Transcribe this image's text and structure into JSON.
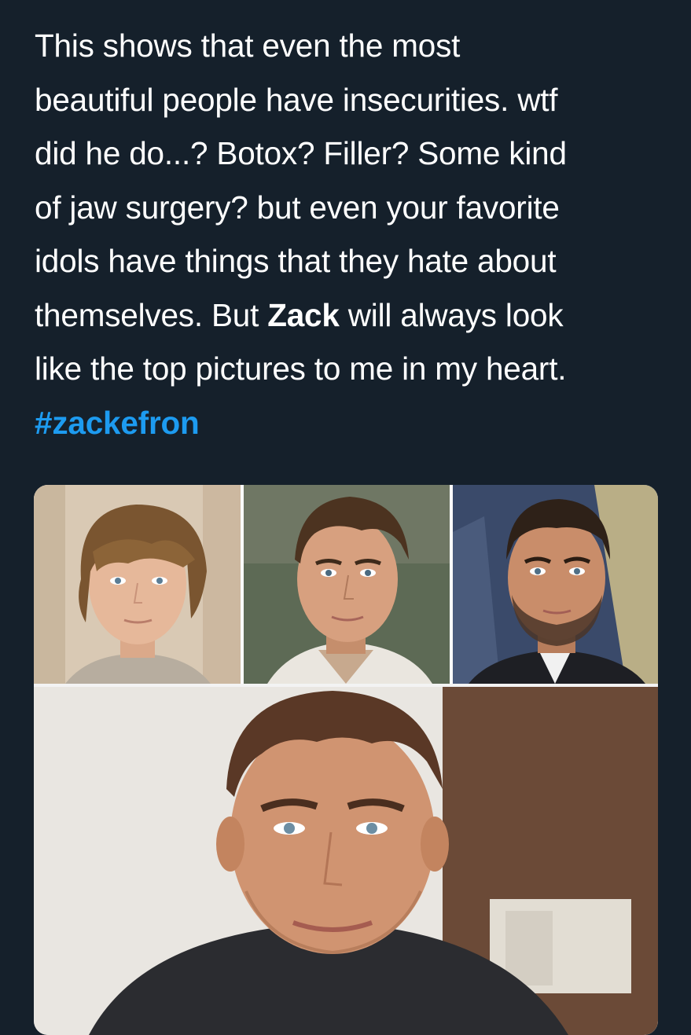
{
  "tweet": {
    "text_before_name": "This shows that even the most\nbeautiful people have insecurities. wtf\ndid he do...? Botox? Filler? Some kind\nof jaw surgery? but even your favorite\nidols have things that they hate about\nthemselves. But ",
    "bold_name": "Zack",
    "text_after_name": " will always look\nlike the top pictures to me in my heart.",
    "hashtag": "#zackefron"
  },
  "media": {
    "photos": [
      {
        "name": "young-portrait",
        "icon": "portrait-photo"
      },
      {
        "name": "teen-portrait",
        "icon": "portrait-photo"
      },
      {
        "name": "adult-portrait",
        "icon": "portrait-photo"
      },
      {
        "name": "recent-portrait",
        "icon": "portrait-photo"
      }
    ]
  },
  "colors": {
    "background": "#15202b",
    "text": "#ffffff",
    "link": "#1d9bf0"
  }
}
